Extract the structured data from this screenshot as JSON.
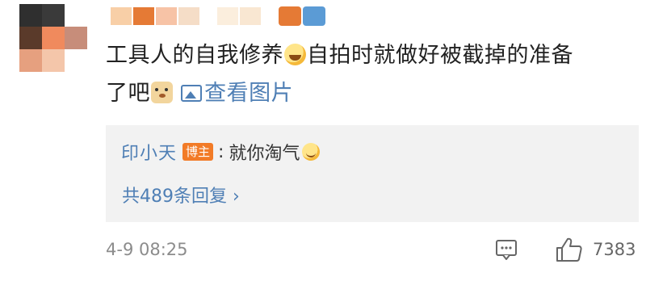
{
  "avatar": {
    "pixels": [
      "#2f2f2f",
      "#3a3a3a",
      "#ffffff",
      "#5a3a2a",
      "#f08a5d",
      "#c78d7a",
      "#e6a07f",
      "#f4c6aa",
      "#ffffff"
    ]
  },
  "username": {
    "pixels": [
      "#f8cfa7",
      "#e57a35",
      "#f7c3a6",
      "#f5ddc7",
      "#fbeedd",
      "#f9e7d2"
    ],
    "badge_colors": [
      "#e57a35",
      "#5b9bd5"
    ]
  },
  "comment": {
    "text_part1": "工具人的自我修养",
    "text_part2": "自拍时就做好被截掉的准备",
    "text_part3": "了吧",
    "view_picture_label": "查看图片",
    "emoji1": "laugh-cry-emoji",
    "emoji2": "doge-emoji"
  },
  "reply": {
    "user": "印小天",
    "badge": "博主",
    "separator": ":",
    "text": "就你淘气",
    "emoji": "smile-emoji",
    "more_label": "共489条回复 ›"
  },
  "footer": {
    "time": "4-9 08:25",
    "like_count": "7383"
  },
  "colors": {
    "link": "#4f7fb5",
    "badge": "#f27b27",
    "reply_bg": "#f2f2f2"
  }
}
